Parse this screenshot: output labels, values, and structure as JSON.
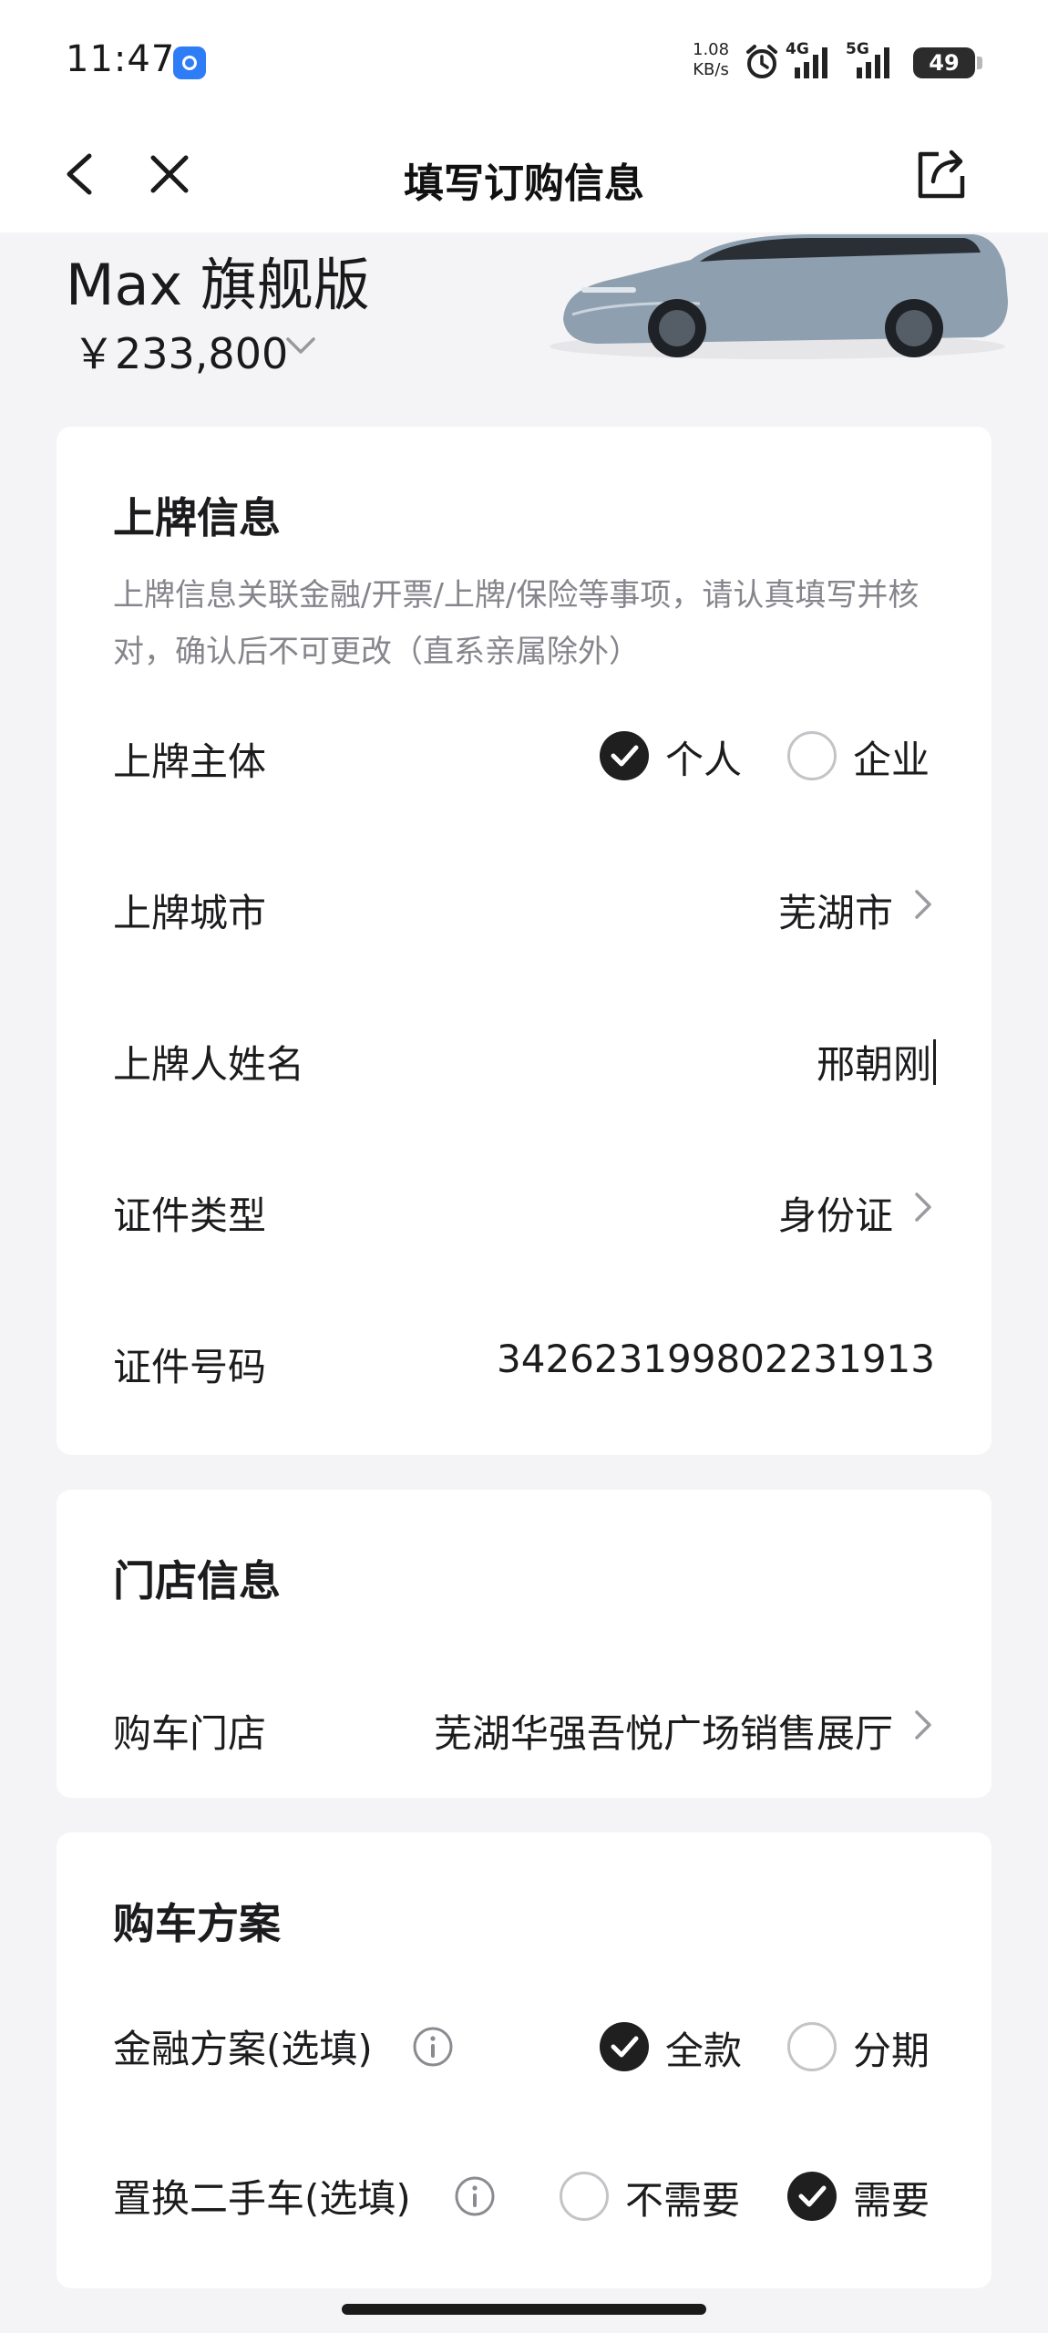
{
  "status_bar": {
    "time": "11:47",
    "net_speed_value": "1.08",
    "net_speed_unit": "KB/s",
    "signal_1_tag": "4G",
    "signal_2_tag": "5G",
    "battery": "49",
    "icons": [
      "app-notification-icon",
      "alarm-icon",
      "signal-icon",
      "battery-icon"
    ]
  },
  "nav": {
    "title": "填写订购信息",
    "icons": [
      "back-icon",
      "close-icon",
      "share-icon"
    ]
  },
  "car": {
    "name": "Max 旗舰版",
    "price": "￥233,800"
  },
  "plate_info": {
    "title": "上牌信息",
    "description": "上牌信息关联金融/开票/上牌/保险等事项，请认真填写并核对，确认后不可更改（直系亲属除外）",
    "subject": {
      "label": "上牌主体",
      "options": [
        {
          "label": "个人",
          "selected": true
        },
        {
          "label": "企业",
          "selected": false
        }
      ]
    },
    "city": {
      "label": "上牌城市",
      "value": "芜湖市"
    },
    "owner_name": {
      "label": "上牌人姓名",
      "value": "邢朝刚"
    },
    "id_type": {
      "label": "证件类型",
      "value": "身份证"
    },
    "id_number": {
      "label": "证件号码",
      "value": "342623199802231913"
    }
  },
  "store_info": {
    "title": "门店信息",
    "store": {
      "label": "购车门店",
      "value": "芜湖华强吾悦广场销售展厅"
    }
  },
  "purchase_plan": {
    "title": "购车方案",
    "finance": {
      "label": "金融方案(选填)",
      "options": [
        {
          "label": "全款",
          "selected": true
        },
        {
          "label": "分期",
          "selected": false
        }
      ]
    },
    "trade_in": {
      "label": "置换二手车(选填)",
      "options": [
        {
          "label": "不需要",
          "selected": false
        },
        {
          "label": "需要",
          "selected": true
        }
      ]
    }
  },
  "colors": {
    "accent": "#1f1f1f",
    "background": "#f4f4f6",
    "secondary_text": "#85858c"
  }
}
